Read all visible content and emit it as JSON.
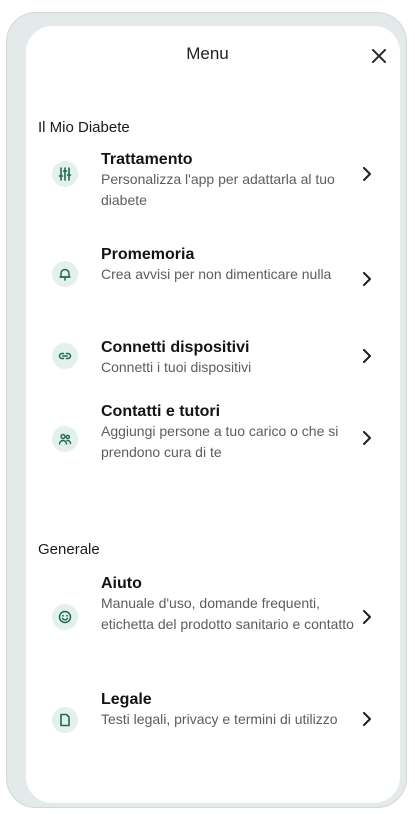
{
  "header": {
    "title": "Menu"
  },
  "sections": {
    "mio_diabete": "Il Mio Diabete",
    "generale": "Generale"
  },
  "items": [
    {
      "title": "Trattamento",
      "desc": "Personalizza l'app per adattarla al tuo diabete",
      "icon": "settings-sliders-icon"
    },
    {
      "title": "Promemoria",
      "desc": "Crea avvisi per non dimenticare nulla",
      "icon": "bell-icon"
    },
    {
      "title": "Connetti dispositivi",
      "desc": "Connetti i tuoi dispositivi",
      "icon": "link-icon"
    },
    {
      "title": "Contatti e tutori",
      "desc": "Aggiungi persone a tuo carico o che si prendono cura di te",
      "icon": "people-icon"
    },
    {
      "title": "Aiuto",
      "desc": "Manuale d'uso, domande frequenti, etichetta del prodotto sanitario e contatto",
      "icon": "smiley-icon"
    },
    {
      "title": "Legale",
      "desc": "Testi legali, privacy e termini di utilizzo",
      "icon": "document-icon"
    }
  ],
  "colors": {
    "accent": "#1e6b52",
    "icon_bg": "#e3f0ec",
    "frame_bg": "#e4eae9"
  }
}
